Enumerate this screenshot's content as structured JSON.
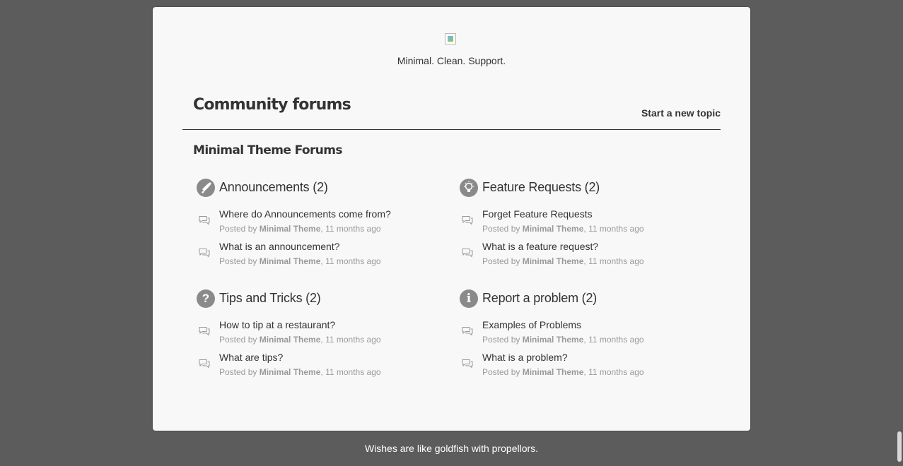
{
  "site": {
    "tagline": "Minimal. Clean. Support.",
    "logo_icon": "broken-image-icon"
  },
  "header": {
    "title": "Community forums",
    "new_topic_label": "Start a new topic"
  },
  "section": {
    "title": "Minimal Theme Forums"
  },
  "forums": [
    {
      "name": "Announcements (2)",
      "icon": "megaphone-icon",
      "topics": [
        {
          "title": "Where do Announcements come from?",
          "posted_by": "Posted by",
          "author": "Minimal Theme",
          "time": ", 11 months ago"
        },
        {
          "title": "What is an announcement?",
          "posted_by": "Posted by",
          "author": "Minimal Theme",
          "time": ", 11 months ago"
        }
      ]
    },
    {
      "name": "Feature Requests (2)",
      "icon": "lightbulb-icon",
      "topics": [
        {
          "title": "Forget Feature Requests",
          "posted_by": "Posted by",
          "author": "Minimal Theme",
          "time": ", 11 months ago"
        },
        {
          "title": "What is a feature request?",
          "posted_by": "Posted by",
          "author": "Minimal Theme",
          "time": ", 11 months ago"
        }
      ]
    },
    {
      "name": "Tips and Tricks (2)",
      "icon": "question-icon",
      "icon_glyph": "?",
      "topics": [
        {
          "title": "How to tip at a restaurant?",
          "posted_by": "Posted by",
          "author": "Minimal Theme",
          "time": ", 11 months ago"
        },
        {
          "title": "What are tips?",
          "posted_by": "Posted by",
          "author": "Minimal Theme",
          "time": ", 11 months ago"
        }
      ]
    },
    {
      "name": "Report a problem (2)",
      "icon": "info-icon",
      "icon_glyph": "i",
      "topics": [
        {
          "title": "Examples of Problems",
          "posted_by": "Posted by",
          "author": "Minimal Theme",
          "time": ", 11 months ago"
        },
        {
          "title": "What is a problem?",
          "posted_by": "Posted by",
          "author": "Minimal Theme",
          "time": ", 11 months ago"
        }
      ]
    }
  ],
  "footer": {
    "quote": "Wishes are like goldfish with propellors."
  },
  "colors": {
    "background": "#5c5c5c",
    "card": "#f8f8f8",
    "text": "#333333",
    "muted": "#9a9a9a",
    "icon": "#8a8a8a"
  }
}
